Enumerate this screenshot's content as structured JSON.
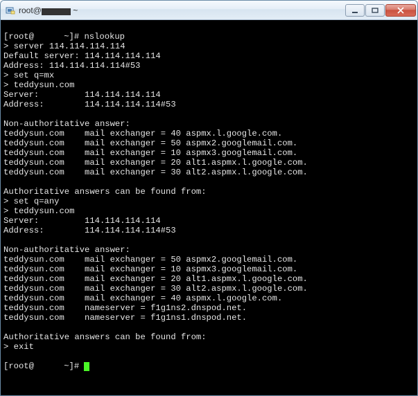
{
  "window": {
    "title_prefix": "root@",
    "title_suffix": " ~",
    "icon_name": "putty-icon"
  },
  "controls": {
    "minimize": "minimize",
    "maximize": "maximize",
    "close": "close"
  },
  "terminal": {
    "prompt_open": "[root@",
    "prompt_mid": " ~]#",
    "cmd0": " nslookup",
    "line1": "> server 114.114.114.114",
    "line2": "Default server: 114.114.114.114",
    "line3": "Address: 114.114.114.114#53",
    "line4": "> set q=mx",
    "line5": "> teddysun.com",
    "line6": "Server:         114.114.114.114",
    "line7": "Address:        114.114.114.114#53",
    "line8": "",
    "line9": "Non-authoritative answer:",
    "line10": "teddysun.com    mail exchanger = 40 aspmx.l.google.com.",
    "line11": "teddysun.com    mail exchanger = 50 aspmx2.googlemail.com.",
    "line12": "teddysun.com    mail exchanger = 10 aspmx3.googlemail.com.",
    "line13": "teddysun.com    mail exchanger = 20 alt1.aspmx.l.google.com.",
    "line14": "teddysun.com    mail exchanger = 30 alt2.aspmx.l.google.com.",
    "line15": "",
    "line16": "Authoritative answers can be found from:",
    "line17": "> set q=any",
    "line18": "> teddysun.com",
    "line19": "Server:         114.114.114.114",
    "line20": "Address:        114.114.114.114#53",
    "line21": "",
    "line22": "Non-authoritative answer:",
    "line23": "teddysun.com    mail exchanger = 50 aspmx2.googlemail.com.",
    "line24": "teddysun.com    mail exchanger = 10 aspmx3.googlemail.com.",
    "line25": "teddysun.com    mail exchanger = 20 alt1.aspmx.l.google.com.",
    "line26": "teddysun.com    mail exchanger = 30 alt2.aspmx.l.google.com.",
    "line27": "teddysun.com    mail exchanger = 40 aspmx.l.google.com.",
    "line28": "teddysun.com    nameserver = f1g1ns2.dnspod.net.",
    "line29": "teddysun.com    nameserver = f1g1ns1.dnspod.net.",
    "line30": "",
    "line31": "Authoritative answers can be found from:",
    "line32": "> exit",
    "line33": "",
    "prompt2_open": "[root@",
    "prompt2_mid": " ~]# "
  }
}
